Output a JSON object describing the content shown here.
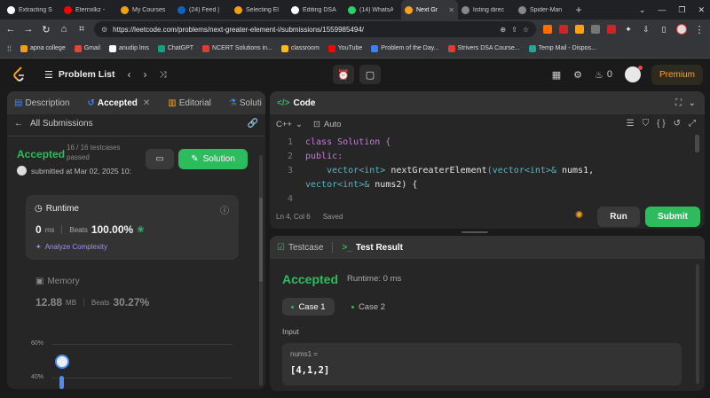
{
  "browser": {
    "tabs": [
      {
        "label": "Extracting S",
        "color": "#ffffff"
      },
      {
        "label": "Eternxlkz -",
        "color": "#ff0000"
      },
      {
        "label": "My Courses",
        "color": "#f59e0b"
      },
      {
        "label": "(24) Feed |",
        "color": "#0a66c2"
      },
      {
        "label": "Selecting El",
        "color": "#f59e0b"
      },
      {
        "label": "Editing DSA",
        "color": "#ffffff"
      },
      {
        "label": "(14) WhatsA",
        "color": "#25d366"
      },
      {
        "label": "Next Gr",
        "color": "#ffa116"
      },
      {
        "label": "listing direc",
        "color": "#888888"
      },
      {
        "label": "Spider-Man",
        "color": "#888888"
      }
    ],
    "new_tab": "+",
    "url": "https://leetcode.com/problems/next-greater-element-i/submissions/1559985494/",
    "bookmarks": [
      "apna college",
      "Gmail",
      "anudip lms",
      "ChatGPT",
      "NCERT Solutions in...",
      "classroom",
      "YouTube",
      "Problem of the Day...",
      "Strivers DSA Course...",
      "Temp Mail - Dispos..."
    ]
  },
  "lcnav": {
    "problem_list": "Problem List",
    "streak": "0",
    "premium": "Premium"
  },
  "left": {
    "tabs": {
      "description": "Description",
      "accepted": "Accepted",
      "editorial": "Editorial",
      "solutions": "Soluti"
    },
    "all_submissions": "All Submissions",
    "status": "Accepted",
    "testcases": "16 / 16 testcases",
    "passed": "passed",
    "submitted": "submitted at Mar 02, 2025 10:",
    "solution_btn": "Solution",
    "runtime": {
      "title": "Runtime",
      "value": "0",
      "unit": "ms",
      "beats_label": "Beats",
      "beats": "100.00%",
      "analyze": "Analyze Complexity"
    },
    "memory": {
      "title": "Memory",
      "value": "12.88",
      "unit": "MB",
      "beats_label": "Beats",
      "beats": "30.27%"
    },
    "chart_ticks": [
      "60%",
      "40%"
    ]
  },
  "code": {
    "title": "Code",
    "lang": "C++",
    "auto": "Auto",
    "lines": [
      {
        "n": "1",
        "segments": [
          {
            "t": "class Solution {",
            "c": "#c678dd"
          }
        ]
      },
      {
        "n": "2",
        "segments": [
          {
            "t": "public:",
            "c": "#c678dd"
          }
        ]
      },
      {
        "n": "3",
        "segments": [
          {
            "t": "    vector<int> ",
            "c": "#56b6c2"
          },
          {
            "t": "nextGreaterElement",
            "c": "#e5e5e5"
          },
          {
            "t": "(vector<int>& ",
            "c": "#56b6c2"
          },
          {
            "t": "nums1,",
            "c": "#e5e5e5"
          }
        ]
      },
      {
        "n": "",
        "segments": [
          {
            "t": "vector<int>& ",
            "c": "#56b6c2"
          },
          {
            "t": "nums2) {",
            "c": "#e5e5e5"
          }
        ]
      },
      {
        "n": "4",
        "segments": [
          {
            "t": "",
            "c": "#e5e5e5"
          }
        ]
      }
    ],
    "status": "Ln 4, Col 6",
    "saved": "Saved",
    "run": "Run",
    "submit": "Submit"
  },
  "result": {
    "testcase_tab": "Testcase",
    "result_tab": "Test Result",
    "status": "Accepted",
    "runtime": "Runtime: 0 ms",
    "case1": "Case 1",
    "case2": "Case 2",
    "input_label": "Input",
    "var": "nums1 =",
    "value": "[4,1,2]"
  }
}
